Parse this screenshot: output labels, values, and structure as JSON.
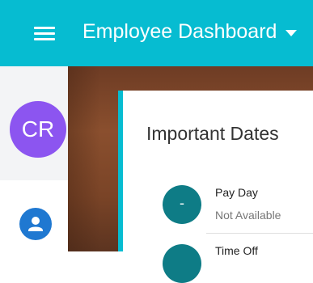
{
  "appbar": {
    "title": "Employee Dashboard",
    "background": "#06bcd1"
  },
  "sidebar": {
    "avatar_initials": "CR",
    "avatar_color": "#8c55f0",
    "nav_icon_color": "#1f78d1"
  },
  "card": {
    "title": "Important Dates",
    "accent": "#06bcd1",
    "items": [
      {
        "badge": "-",
        "title": "Pay Day",
        "subtitle": "Not Available"
      },
      {
        "badge": "",
        "title": "Time Off",
        "subtitle": ""
      }
    ]
  }
}
